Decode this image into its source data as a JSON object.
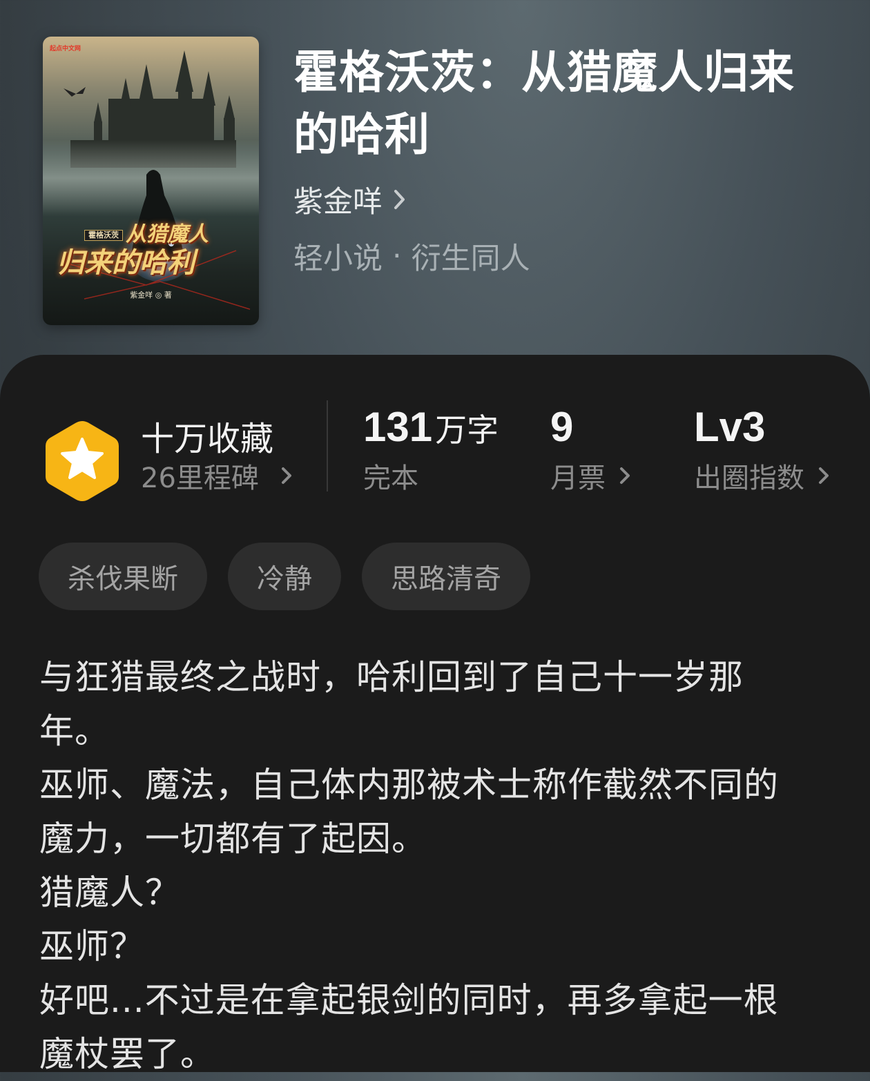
{
  "book": {
    "title_line1": "霍格沃茨：从猎魔人归来",
    "title_line2": "的哈利",
    "author": "紫金咩",
    "category": "轻小说",
    "subcategory": "衍生同人"
  },
  "cover": {
    "publisher": "起点中文网",
    "series": "霍格沃茨",
    "line1": "从猎魔人",
    "line2": "归来的哈利",
    "author_credit": "紫金咩 ◎ 著"
  },
  "stats": {
    "milestone_title": "十万收藏",
    "milestone_count": "26里程碑",
    "word_count": "131",
    "word_unit": "万字",
    "status": "完本",
    "monthly_votes": "9",
    "monthly_votes_label": "月票",
    "level": "Lv3",
    "level_label": "出圈指数"
  },
  "tags": [
    "杀伐果断",
    "冷静",
    "思路清奇"
  ],
  "synopsis": [
    "与狂猎最终之战时，哈利回到了自己十一岁那",
    "年。",
    "巫师、魔法，自己体内那被术士称作截然不同的",
    "魔力，一切都有了起因。",
    "猎魔人？",
    "巫师？",
    "好吧...不过是在拿起银剑的同时，再多拿起一根",
    "魔杖罢了。"
  ],
  "icons": {
    "badge": "star-hexagon-icon",
    "chevron": "chevron-right-icon"
  },
  "colors": {
    "badge_fill": "#F7B515",
    "sheet_bg": "#1B1B1B",
    "tag_bg": "#2D2D2D"
  }
}
